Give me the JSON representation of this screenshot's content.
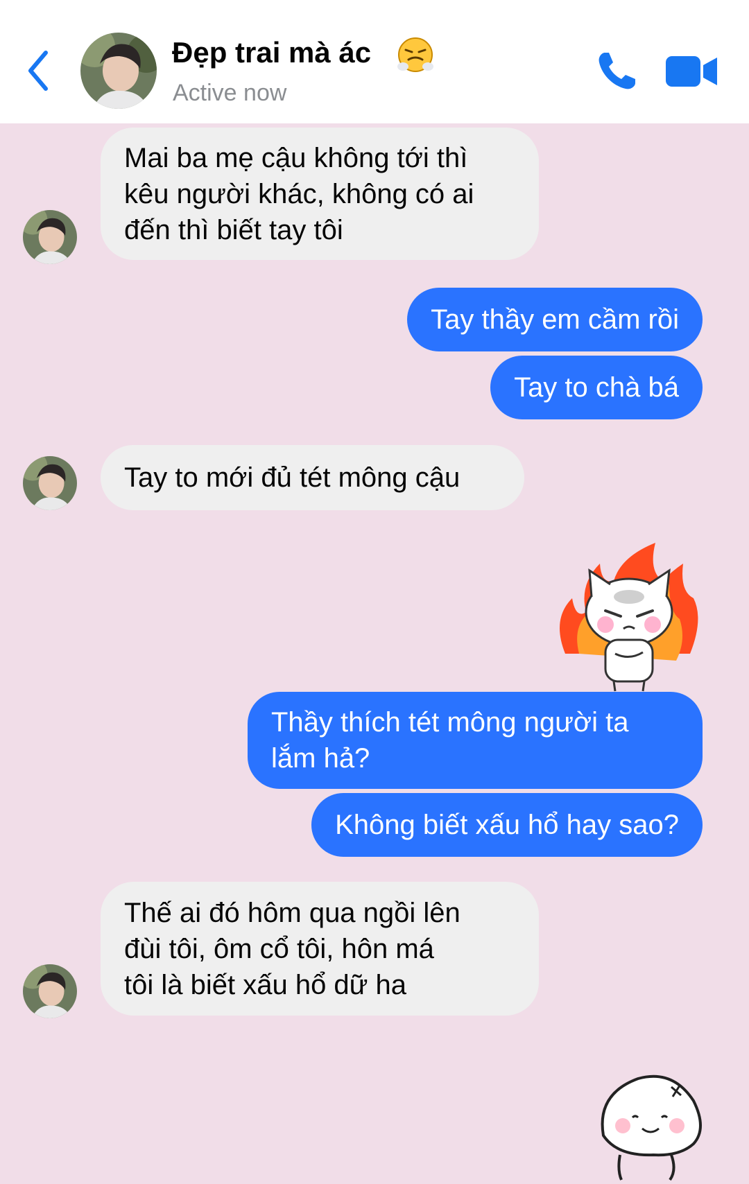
{
  "header": {
    "contact_name": "Đẹp trai mà ác",
    "status": "Active now",
    "back_icon": "chevron-left-icon",
    "call_icon": "phone-icon",
    "video_icon": "video-camera-icon",
    "name_emoji": "face-with-steam-from-nose-emoji",
    "accent_color": "#1877f2"
  },
  "messages": [
    {
      "sender": "contact",
      "text": "Mai ba mẹ cậu không tới thì\nkêu người khác, không có ai\nđến thì biết tay tôi"
    },
    {
      "sender": "me",
      "text": "Tay thầy em cầm rồi"
    },
    {
      "sender": "me",
      "text": "Tay to chà bá"
    },
    {
      "sender": "contact",
      "text": "Tay to mới đủ tét mông cậu"
    },
    {
      "sender": "me",
      "sticker": "angry-cat-fire-sticker"
    },
    {
      "sender": "me",
      "text": "Thầy thích tét mông người ta\nlắm hả?"
    },
    {
      "sender": "me",
      "text": "Không biết xấu hổ hay sao?"
    },
    {
      "sender": "contact",
      "text": "Thế ai đó hôm qua ngồi lên\nđùi tôi, ôm cổ tôi, hôn má\ntôi là biết xấu hổ dữ ha"
    },
    {
      "sender": "me",
      "sticker": "blushing-dumpling-sticker"
    }
  ],
  "colors": {
    "background": "#f1dde8",
    "outgoing_bubble": "#2a73ff",
    "incoming_bubble": "#efefef"
  }
}
